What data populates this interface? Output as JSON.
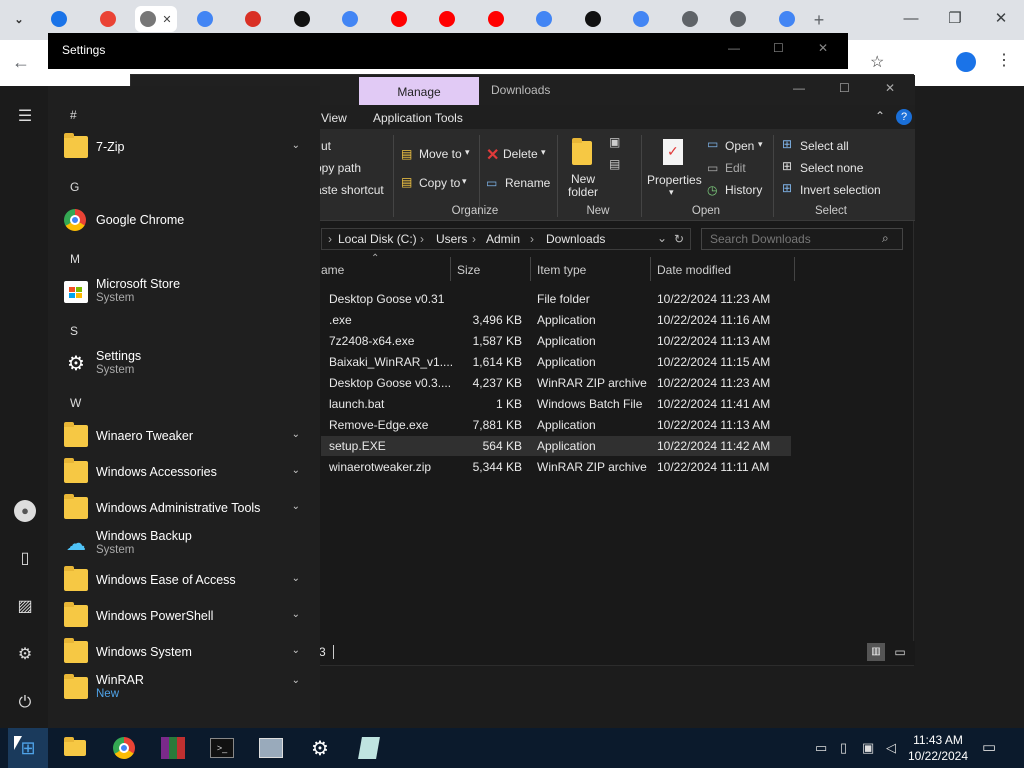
{
  "browser": {
    "tabs": [
      {
        "icon": "app-icon",
        "color": "#1a73e8"
      },
      {
        "icon": "app-icon",
        "color": "#ea4335"
      },
      {
        "icon": "loading-icon",
        "color": "#777",
        "active": true
      },
      {
        "icon": "google-icon",
        "color": "#4285f4"
      },
      {
        "icon": "app-icon",
        "color": "#d93025"
      },
      {
        "icon": "github-icon",
        "color": "#111"
      },
      {
        "icon": "google-icon",
        "color": "#4285f4"
      },
      {
        "icon": "youtube-icon",
        "color": "#ff0000"
      },
      {
        "icon": "youtube-icon",
        "color": "#ff0000"
      },
      {
        "icon": "youtube-icon",
        "color": "#ff0000"
      },
      {
        "icon": "google-icon",
        "color": "#4285f4"
      },
      {
        "icon": "github-icon",
        "color": "#111"
      },
      {
        "icon": "google-icon",
        "color": "#4285f4"
      },
      {
        "icon": "gear-icon",
        "color": "#5f6368"
      },
      {
        "icon": "download-icon",
        "color": "#5f6368"
      },
      {
        "icon": "google-icon",
        "color": "#4285f4"
      }
    ]
  },
  "settings": {
    "title": "Settings"
  },
  "explorer": {
    "tab_manage": "Manage",
    "title": "Downloads",
    "ribbon_tabs": [
      "View",
      "Application Tools"
    ],
    "clipboard": {
      "cut": "ut",
      "copy_path": "opy path",
      "paste_shortcut": "aste shortcut"
    },
    "organize": {
      "move_to": "Move to",
      "copy_to": "Copy to",
      "delete": "Delete",
      "rename": "Rename",
      "label": "Organize"
    },
    "new": {
      "new_folder": "New folder",
      "label": "New"
    },
    "open": {
      "properties": "Properties",
      "open": "Open",
      "edit": "Edit",
      "history": "History",
      "label": "Open"
    },
    "select": {
      "select_all": "Select all",
      "select_none": "Select none",
      "invert": "Invert selection",
      "label": "Select"
    },
    "address": [
      "Local Disk (C:)",
      "Users",
      "Admin",
      "Downloads"
    ],
    "search_placeholder": "Search Downloads",
    "columns": {
      "name": "ame",
      "size": "Size",
      "type": "Item type",
      "date": "Date modified"
    },
    "files": [
      {
        "name": "Desktop Goose v0.31",
        "size": "",
        "type": "File folder",
        "date": "10/22/2024 11:23 AM"
      },
      {
        "name": ".exe",
        "size": "3,496 KB",
        "type": "Application",
        "date": "10/22/2024 11:16 AM"
      },
      {
        "name": "7z2408-x64.exe",
        "size": "1,587 KB",
        "type": "Application",
        "date": "10/22/2024 11:13 AM"
      },
      {
        "name": "Baixaki_WinRAR_v1....",
        "size": "1,614 KB",
        "type": "Application",
        "date": "10/22/2024 11:15 AM"
      },
      {
        "name": "Desktop Goose v0.3....",
        "size": "4,237 KB",
        "type": "WinRAR ZIP archive",
        "date": "10/22/2024 11:23 AM"
      },
      {
        "name": "launch.bat",
        "size": "1 KB",
        "type": "Windows Batch File",
        "date": "10/22/2024 11:41 AM"
      },
      {
        "name": "Remove-Edge.exe",
        "size": "7,881 KB",
        "type": "Application",
        "date": "10/22/2024 11:13 AM"
      },
      {
        "name": "setup.EXE",
        "size": "564 KB",
        "type": "Application",
        "date": "10/22/2024 11:42 AM",
        "selected": true
      },
      {
        "name": "winaerotweaker.zip",
        "size": "5,344 KB",
        "type": "WinRAR ZIP archive",
        "date": "10/22/2024 11:11 AM"
      }
    ],
    "status": "3"
  },
  "start": {
    "hash": "#",
    "g": "G",
    "m": "M",
    "s": "S",
    "w": "W",
    "apps": {
      "sevenzip": "7-Zip",
      "chrome": "Google Chrome",
      "store": "Microsoft Store",
      "store_sub": "System",
      "settings": "Settings",
      "settings_sub": "System",
      "winaero": "Winaero Tweaker",
      "accessories": "Windows Accessories",
      "admin_tools": "Windows Administrative Tools",
      "backup": "Windows Backup",
      "backup_sub": "System",
      "ease": "Windows Ease of Access",
      "powershell": "Windows PowerShell",
      "system": "Windows System",
      "winrar": "WinRAR",
      "winrar_sub": "New"
    }
  },
  "taskbar": {
    "time": "11:43 AM",
    "date": "10/22/2024"
  }
}
